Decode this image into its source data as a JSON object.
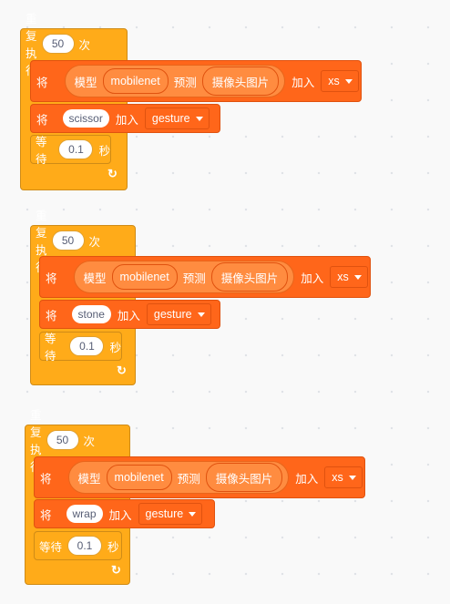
{
  "scripts": [
    {
      "repeat_label": "重复执行",
      "repeat_count": "50",
      "repeat_unit": "次",
      "ml_put": "将",
      "ml_model": "模型",
      "ml_model_name": "mobilenet",
      "ml_predict": "预测",
      "ml_source": "摄像头图片",
      "ml_add": "加入",
      "ml_list": "xs",
      "label_put": "将",
      "label_value": "scissor",
      "label_add": "加入",
      "label_list": "gesture",
      "wait_label": "等待",
      "wait_value": "0.1",
      "wait_unit": "秒",
      "loop_arrow": "↻"
    },
    {
      "repeat_label": "重复执行",
      "repeat_count": "50",
      "repeat_unit": "次",
      "ml_put": "将",
      "ml_model": "模型",
      "ml_model_name": "mobilenet",
      "ml_predict": "预测",
      "ml_source": "摄像头图片",
      "ml_add": "加入",
      "ml_list": "xs",
      "label_put": "将",
      "label_value": "stone",
      "label_add": "加入",
      "label_list": "gesture",
      "wait_label": "等待",
      "wait_value": "0.1",
      "wait_unit": "秒",
      "loop_arrow": "↻"
    },
    {
      "repeat_label": "重复执行",
      "repeat_count": "50",
      "repeat_unit": "次",
      "ml_put": "将",
      "ml_model": "模型",
      "ml_model_name": "mobilenet",
      "ml_predict": "预测",
      "ml_source": "摄像头图片",
      "ml_add": "加入",
      "ml_list": "xs",
      "label_put": "将",
      "label_value": "wrap",
      "label_add": "加入",
      "label_list": "gesture",
      "wait_label": "等待",
      "wait_value": "0.1",
      "wait_unit": "秒",
      "loop_arrow": "↻"
    }
  ]
}
